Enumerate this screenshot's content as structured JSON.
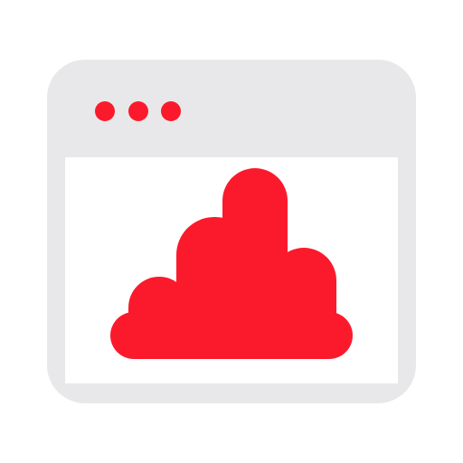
{
  "colors": {
    "frame": "#e8e8ea",
    "content_background": "#ffffff",
    "accent": "#fb1a2c"
  },
  "icons": {
    "window": "browser-window-icon",
    "dots": "window-dots-icon",
    "cloud": "cloud-icon"
  },
  "window_controls": {
    "dot_count": 3
  }
}
